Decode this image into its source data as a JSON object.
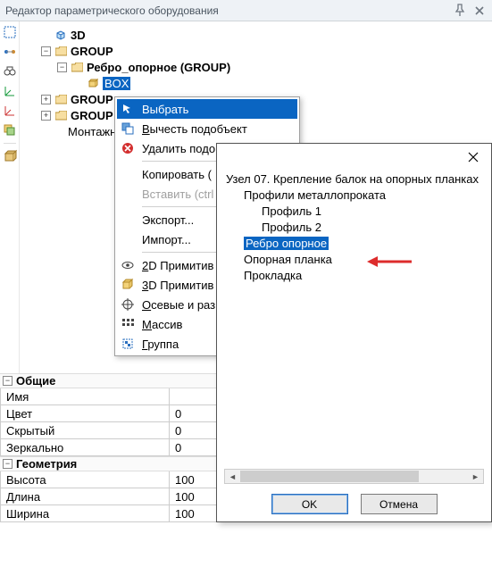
{
  "panel": {
    "title": "Редактор параметрического оборудования"
  },
  "tree": {
    "root_3d": "3D",
    "group1": "GROUP",
    "rebro": "Ребро_опорное (GROUP)",
    "box": "BOX",
    "group2": "GROUP",
    "group3": "GROUP",
    "mount": "Монтажны"
  },
  "context_menu": {
    "select": "Выбрать",
    "subtract": "Вычесть подобъект",
    "delete": "Удалить подо",
    "copy": "Копировать (",
    "paste": "Вставить (ctrl",
    "export": "Экспорт...",
    "import": "Импорт...",
    "prim2d": "2D Примитив",
    "prim3d": "3D Примитив",
    "axes": "Осевые и раз",
    "array": "Массив",
    "group": "Группа"
  },
  "dialog": {
    "title_row": "Узел 07. Крепление балок на опорных планках",
    "profiles": "Профили металлопроката",
    "profile1": "Профиль 1",
    "profile2": "Профиль 2",
    "rebro": "Ребро опорное",
    "planka": "Опорная планка",
    "prokladka": "Прокладка",
    "ok": "OK",
    "cancel": "Отмена"
  },
  "props": {
    "section_general": "Общие",
    "name": "Имя",
    "color": "Цвет",
    "color_val": "0",
    "hidden": "Скрытый",
    "hidden_val": "0",
    "mirrored": "Зеркально",
    "mirrored_val": "0",
    "section_geometry": "Геометрия",
    "height": "Высота",
    "height_val": "100",
    "length": "Длина",
    "length_val": "100",
    "width": "Ширина",
    "width_val": "100"
  }
}
